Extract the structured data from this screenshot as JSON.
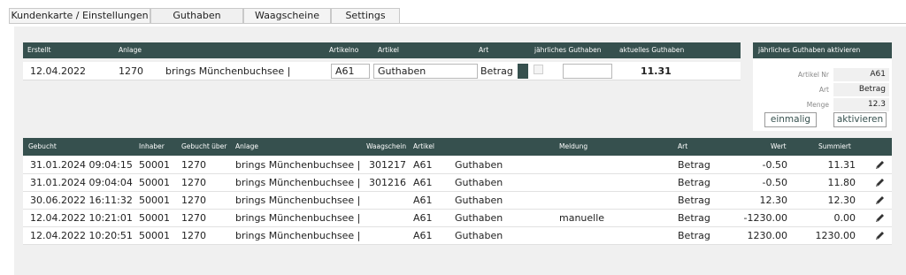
{
  "tabs": [
    {
      "label": "Kundenkarte / Einstellungen",
      "active": false
    },
    {
      "label": "Guthaben",
      "active": true
    },
    {
      "label": "Waagscheine",
      "active": false
    },
    {
      "label": "Settings",
      "active": false
    }
  ],
  "credit_table": {
    "headers": {
      "erstellt": "Erstellt",
      "anlage": "Anlage",
      "artikelno": "Artikelno",
      "artikel": "Artikel",
      "art": "Art",
      "jaehrlich": "jährliches Guthaben",
      "aktuell": "aktuelles Guthaben"
    },
    "row": {
      "erstellt": "12.04.2022",
      "anlage_nr": "1270",
      "anlage_name": "brings Münchenbuchsee  |",
      "artikelno": "A61",
      "artikel": "Guthaben",
      "art": "Betrag",
      "jaehrlich_checked": false,
      "jaehrlich_value": "",
      "aktuell": "11.31"
    }
  },
  "activation": {
    "title": "jährliches Guthaben aktivieren",
    "fields": [
      {
        "label": "Artikel Nr",
        "value": "A61"
      },
      {
        "label": "Art",
        "value": "Betrag"
      },
      {
        "label": "Menge",
        "value": "12.3"
      }
    ],
    "btn_einmalig": "einmalig",
    "btn_aktivieren": "aktivieren"
  },
  "bookings": {
    "headers": {
      "gebucht": "Gebucht",
      "inhaber": "Inhaber",
      "gebucht_ueber": "Gebucht über",
      "anlage": "Anlage",
      "waagschein": "Waagschein",
      "artikel": "Artikel",
      "meldung": "Meldung",
      "art": "Art",
      "wert": "Wert",
      "summiert": "Summiert"
    },
    "rows": [
      {
        "gebucht": "31.01.2024 09:04:15",
        "inhaber": "50001",
        "ueber": "1270",
        "anlage": "brings Münchenbuchsee  |",
        "waagschein": "301217",
        "artno": "A61",
        "artikel": "Guthaben",
        "meldung": "",
        "art": "Betrag",
        "wert": "-0.50",
        "summiert": "11.31"
      },
      {
        "gebucht": "31.01.2024 09:04:04",
        "inhaber": "50001",
        "ueber": "1270",
        "anlage": "brings Münchenbuchsee  |",
        "waagschein": "301216",
        "artno": "A61",
        "artikel": "Guthaben",
        "meldung": "",
        "art": "Betrag",
        "wert": "-0.50",
        "summiert": "11.80"
      },
      {
        "gebucht": "30.06.2022 16:11:32",
        "inhaber": "50001",
        "ueber": "1270",
        "anlage": "brings Münchenbuchsee  |",
        "waagschein": "",
        "artno": "A61",
        "artikel": "Guthaben",
        "meldung": "",
        "art": "Betrag",
        "wert": "12.30",
        "summiert": "12.30"
      },
      {
        "gebucht": "12.04.2022 10:21:01",
        "inhaber": "50001",
        "ueber": "1270",
        "anlage": "brings Münchenbuchsee  |",
        "waagschein": "",
        "artno": "A61",
        "artikel": "Guthaben",
        "meldung": "manuelle",
        "art": "Betrag",
        "wert": "-1230.00",
        "summiert": "0.00"
      },
      {
        "gebucht": "12.04.2022 10:20:51",
        "inhaber": "50001",
        "ueber": "1270",
        "anlage": "brings Münchenbuchsee  |",
        "waagschein": "",
        "artno": "A61",
        "artikel": "Guthaben",
        "meldung": "",
        "art": "Betrag",
        "wert": "1230.00",
        "summiert": "1230.00"
      }
    ]
  },
  "icons": {
    "edit": "pencil-icon"
  },
  "colors": {
    "header_bg": "#36504e",
    "panel_bg": "#f0f0f0"
  }
}
